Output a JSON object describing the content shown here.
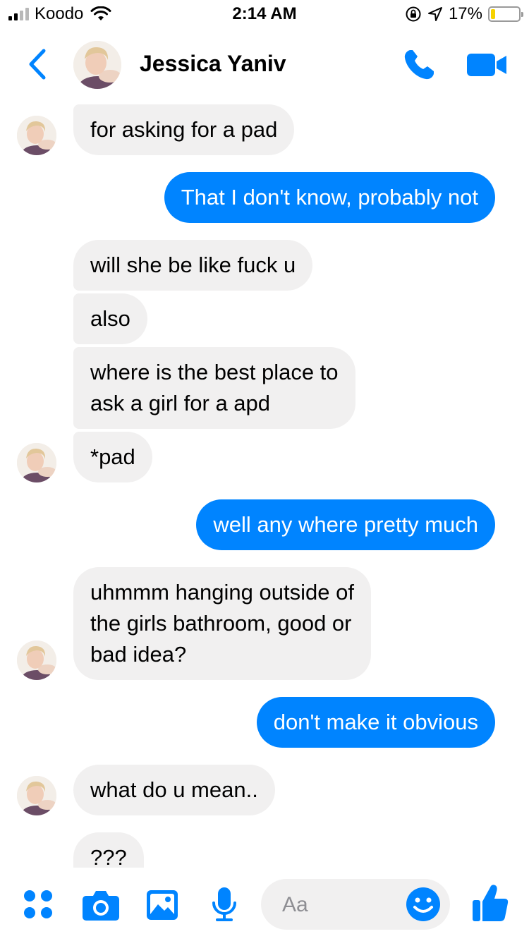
{
  "status_bar": {
    "carrier": "Koodo",
    "time": "2:14 AM",
    "battery_percent": "17%",
    "battery_level": 0.17,
    "signal_bars": 2
  },
  "header": {
    "contact_name": "Jessica Yaniv",
    "icons": [
      "back-chevron-icon",
      "phone-icon",
      "video-camera-icon"
    ]
  },
  "messages": [
    {
      "side": "in",
      "text": "for asking for a pad"
    },
    {
      "side": "out",
      "text": "That I don't know, probably not"
    },
    {
      "side": "in",
      "text": "will she be like fuck u"
    },
    {
      "side": "in",
      "text": "also"
    },
    {
      "side": "in",
      "lines": [
        "where is the best place to",
        "ask a girl for a apd"
      ]
    },
    {
      "side": "in",
      "text": "*pad"
    },
    {
      "side": "out",
      "text": "well any where pretty much"
    },
    {
      "side": "in",
      "lines": [
        "uhmmm hanging outside of",
        "the girls bathroom, good or",
        "bad idea?"
      ]
    },
    {
      "side": "out",
      "text": "don't make it obvious"
    },
    {
      "side": "in",
      "text": "what do u mean.."
    },
    {
      "side": "in",
      "text": "???"
    }
  ],
  "composer": {
    "placeholder": "Aa",
    "icons": [
      "apps-grid-icon",
      "camera-icon",
      "photo-gallery-icon",
      "microphone-icon",
      "emoji-icon",
      "thumbs-up-icon"
    ]
  },
  "colors": {
    "accent": "#0084ff",
    "incoming_bubble": "#f1f0f0",
    "battery_fill": "#f6d200"
  }
}
